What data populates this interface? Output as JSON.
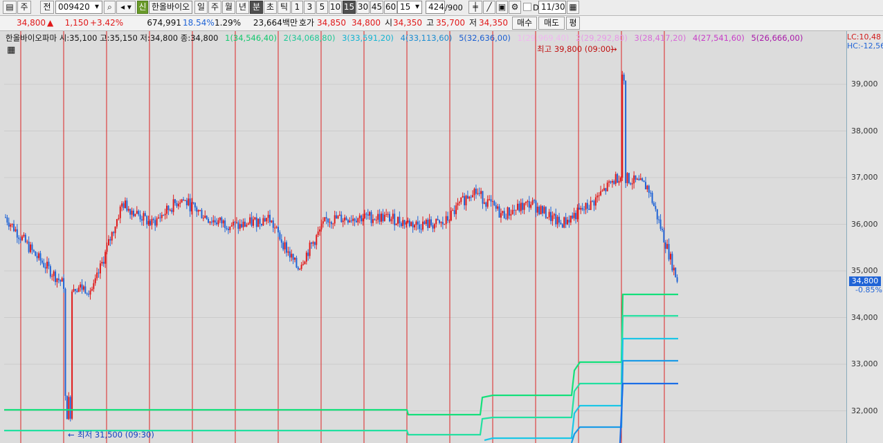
{
  "toolbar": {
    "period_label": "주",
    "prev_label": "전",
    "stock_code": "009420",
    "credit_badge": "신",
    "stock_name": "한올바이오",
    "tabs": [
      "일",
      "주",
      "월",
      "년",
      "분",
      "초",
      "틱"
    ],
    "selected_tab": "분",
    "intervals": [
      "1",
      "3",
      "5",
      "10",
      "15",
      "30",
      "45",
      "60"
    ],
    "selected_interval": "15",
    "interval_select": "15",
    "count": "424",
    "count_total": "/900",
    "checkbox_label": "D",
    "date": "11/30"
  },
  "quote": {
    "price": "34,800",
    "change": "1,150",
    "rate": "+3.42%",
    "volume": "674,991",
    "turnover_rate": "18.54%",
    "ratio": "1.29%",
    "amount": "23,664백만",
    "ask_label": "호가",
    "ask": "34,850",
    "bid": "34,800",
    "open_label": "시",
    "open": "34,350",
    "high_label": "고",
    "high": "35,700",
    "low_label": "저",
    "low": "34,350",
    "buy_label": "매수",
    "sell_label": "매도",
    "more_label": "평"
  },
  "legend": {
    "title": "한올바이오파마 시:35,100 고:35,150 저:34,800 종:34,800",
    "lines_a": [
      "1(34,546,40)",
      "2(34,068,80)",
      "3(33,591,20)",
      "4(33,113,60)",
      "5(32,636,00)"
    ],
    "lines_b": [
      "1(29,969,40)",
      "2(29,292,80)",
      "3(28,417,20)",
      "4(27,541,60)",
      "5(26,666,00)"
    ]
  },
  "annotations": {
    "max_label": "최고 39,800 (09:00)",
    "min_label": "최저 31,500 (09:30)",
    "lc": "LC:10,48",
    "hc": "HC:-12,56"
  },
  "axis": {
    "ticks": [
      "39,000",
      "38,000",
      "37,000",
      "36,000",
      "35,000",
      "34,000",
      "33,000",
      "32,000"
    ],
    "current": "34,800",
    "current_rate": "-0.85%"
  },
  "colors": {
    "up": "#e0191a",
    "down": "#1f63d6",
    "line1": "#13e07a",
    "line2": "#22e0a0",
    "line3": "#1ac6e6",
    "line4": "#1a9ae6",
    "line5": "#1a6ee6"
  },
  "chart_data": {
    "type": "candlestick",
    "y_range": [
      31500,
      39800
    ],
    "price_ticks": [
      39000,
      38000,
      37000,
      36000,
      35000,
      34000,
      33000,
      32000
    ],
    "highest": 39800,
    "lowest": 31500,
    "last": 34800,
    "session_close_trend": [
      36150,
      35350,
      34700,
      34600,
      36450,
      36000,
      36550,
      36100,
      35950,
      36150,
      35050,
      36100,
      36150,
      36150,
      36000,
      36000,
      36750,
      36200,
      36450,
      36000,
      36400,
      37050,
      36800,
      34800
    ]
  }
}
